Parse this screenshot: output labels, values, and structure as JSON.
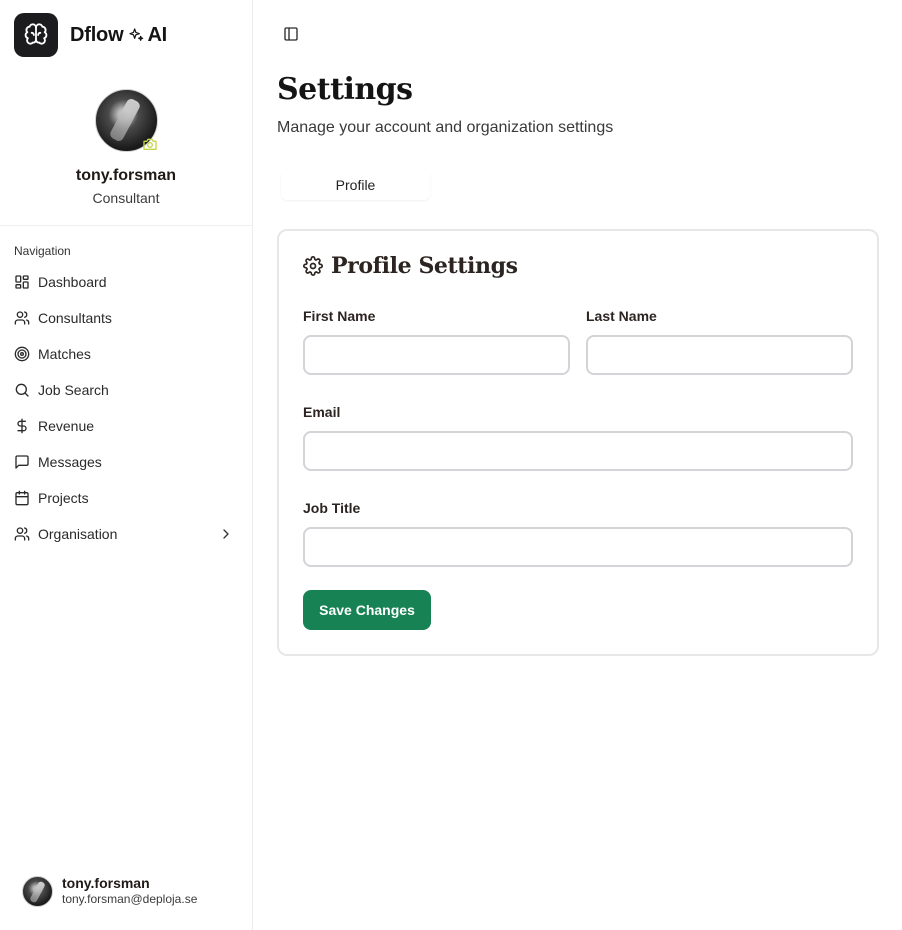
{
  "brand": {
    "name": "Dflow",
    "suffix": "AI",
    "logo_icon": "brain-icon"
  },
  "profile": {
    "username": "tony.forsman",
    "role": "Consultant",
    "camera_icon": "camera-icon",
    "camera_color": "#c6d64a"
  },
  "navigation": {
    "heading": "Navigation",
    "items": [
      {
        "label": "Dashboard",
        "icon": "dashboard-icon"
      },
      {
        "label": "Consultants",
        "icon": "users-icon"
      },
      {
        "label": "Matches",
        "icon": "target-icon"
      },
      {
        "label": "Job Search",
        "icon": "search-icon"
      },
      {
        "label": "Revenue",
        "icon": "dollar-icon"
      },
      {
        "label": "Messages",
        "icon": "message-icon"
      },
      {
        "label": "Projects",
        "icon": "calendar-icon"
      },
      {
        "label": "Organisation",
        "icon": "users-icon",
        "has_children": true
      }
    ]
  },
  "user_footer": {
    "name": "tony.forsman",
    "email": "tony.forsman@deploja.se"
  },
  "page": {
    "title": "Settings",
    "subtitle": "Manage your account and organization settings"
  },
  "tabs": [
    {
      "label": "Profile",
      "active": true
    }
  ],
  "profile_settings": {
    "title": "Profile Settings",
    "icon": "gear-icon",
    "fields": {
      "first_name": {
        "label": "First Name",
        "value": ""
      },
      "last_name": {
        "label": "Last Name",
        "value": ""
      },
      "email": {
        "label": "Email",
        "value": ""
      },
      "job_title": {
        "label": "Job Title",
        "value": ""
      }
    },
    "save_label": "Save Changes"
  },
  "colors": {
    "primary_button": "#178354",
    "logo_bg": "#1c1c1e",
    "border": "#e7e7e7"
  }
}
